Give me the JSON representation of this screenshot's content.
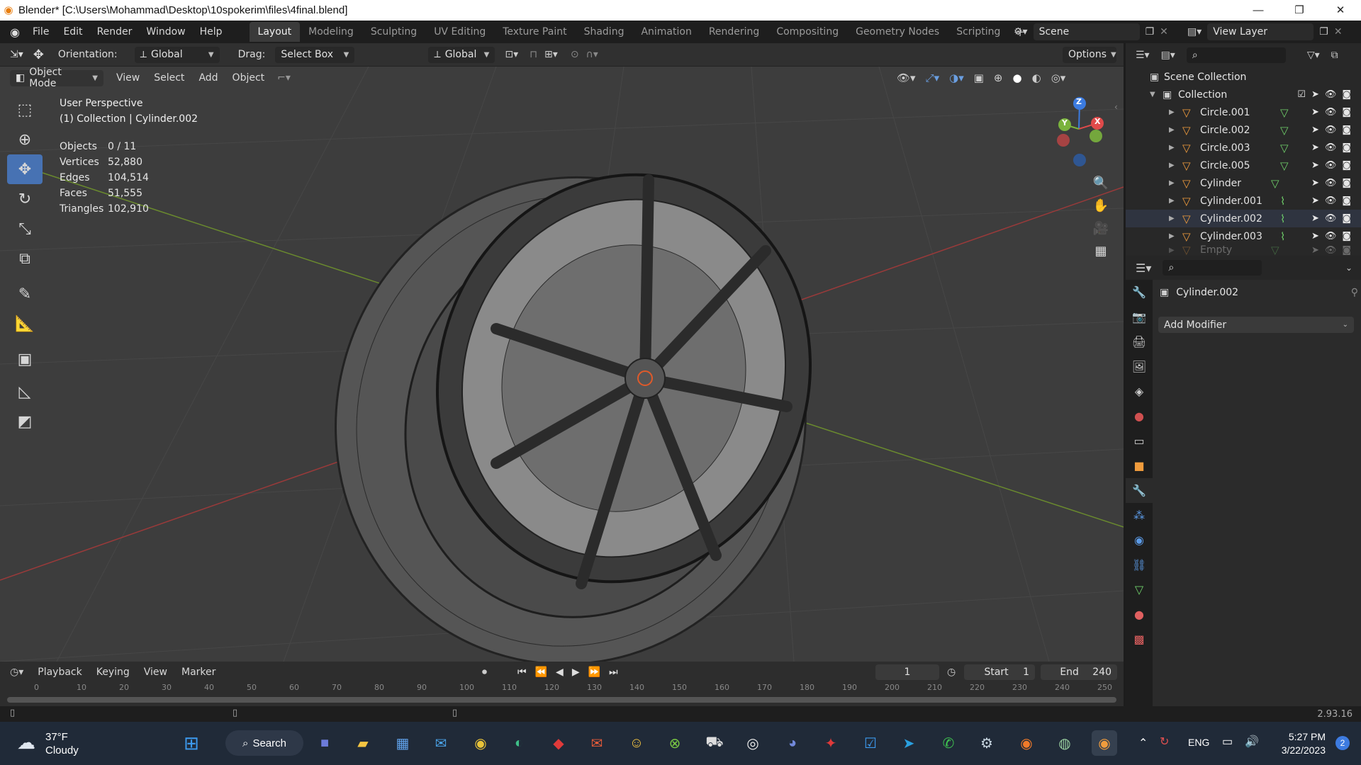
{
  "window": {
    "title": "Blender* [C:\\Users\\Mohammad\\Desktop\\10spokerim\\files\\4final.blend]",
    "minimize": "—",
    "restore": "❐",
    "close": "✕"
  },
  "menu": [
    "File",
    "Edit",
    "Render",
    "Window",
    "Help"
  ],
  "workspaces": [
    "Layout",
    "Modeling",
    "Sculpting",
    "UV Editing",
    "Texture Paint",
    "Shading",
    "Animation",
    "Rendering",
    "Compositing",
    "Geometry Nodes",
    "Scripting"
  ],
  "active_workspace": "Layout",
  "add_workspace": "+",
  "scene": {
    "label": "Scene"
  },
  "view_layer": {
    "label": "View Layer"
  },
  "toolsettings": {
    "orientation_label": "Orientation:",
    "orientation_value": "Global",
    "drag_label": "Drag:",
    "drag_value": "Select Box",
    "transform_orientation": "Global",
    "options": "Options"
  },
  "viewport_header": {
    "mode": "Object Mode",
    "menus": [
      "View",
      "Select",
      "Add",
      "Object"
    ]
  },
  "viewport": {
    "perspective": "User Perspective",
    "collection_info": "(1) Collection | Cylinder.002",
    "stats": [
      {
        "k": "Objects",
        "v": "0 / 11"
      },
      {
        "k": "Vertices",
        "v": "52,880"
      },
      {
        "k": "Edges",
        "v": "104,514"
      },
      {
        "k": "Faces",
        "v": "51,555"
      },
      {
        "k": "Triangles",
        "v": "102,910"
      }
    ],
    "gizmo": {
      "x": "X",
      "y": "Y",
      "z": "Z"
    }
  },
  "outliner": {
    "scene_collection": "Scene Collection",
    "collection": "Collection",
    "items": [
      {
        "name": "Circle.001",
        "mod": "mesh"
      },
      {
        "name": "Circle.002",
        "mod": "mesh"
      },
      {
        "name": "Circle.003",
        "mod": "mesh"
      },
      {
        "name": "Circle.005",
        "mod": "mesh"
      },
      {
        "name": "Cylinder",
        "mod": "mesh"
      },
      {
        "name": "Cylinder.001",
        "mod": "curve"
      },
      {
        "name": "Cylinder.002",
        "mod": "curve"
      },
      {
        "name": "Cylinder.003",
        "mod": "curve"
      },
      {
        "name": "Empty",
        "mod": "empty"
      }
    ]
  },
  "properties": {
    "object_name": "Cylinder.002",
    "add_modifier": "Add Modifier"
  },
  "timeline": {
    "menus": [
      "Playback",
      "Keying",
      "View",
      "Marker"
    ],
    "current_frame": "1",
    "start_label": "Start",
    "start_value": "1",
    "end_label": "End",
    "end_value": "240",
    "ruler": [
      "0",
      "10",
      "20",
      "30",
      "40",
      "50",
      "60",
      "70",
      "80",
      "90",
      "100",
      "110",
      "120",
      "130",
      "140",
      "150",
      "160",
      "170",
      "180",
      "190",
      "200",
      "210",
      "220",
      "230",
      "240",
      "250"
    ]
  },
  "statusbar": {
    "version": "2.93.16"
  },
  "taskbar": {
    "weather_temp": "37°F",
    "weather_desc": "Cloudy",
    "search": "Search",
    "lang": "ENG",
    "time": "5:27 PM",
    "date": "3/22/2023",
    "notif": "2"
  }
}
